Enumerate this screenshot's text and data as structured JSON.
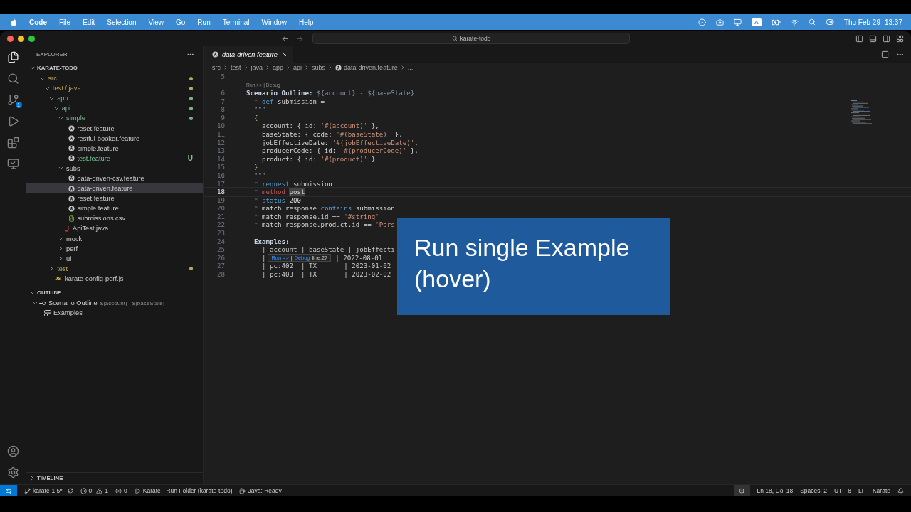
{
  "menu_bar": {
    "app": "Code",
    "items": [
      "File",
      "Edit",
      "Selection",
      "View",
      "Go",
      "Run",
      "Terminal",
      "Window",
      "Help"
    ],
    "input_source": "A",
    "date": "Thu Feb 29",
    "time": "13:37"
  },
  "title_bar": {
    "search": "karate-todo"
  },
  "activity_bar": {
    "source_control_badge": "1"
  },
  "explorer": {
    "title": "EXPLORER",
    "project": {
      "label": "KARATE-TODO",
      "expanded": true
    },
    "tree": [
      {
        "label": "src",
        "kind": "folder",
        "expanded": true,
        "selected": false,
        "color": "#b9a95a",
        "dot": true,
        "children": [
          {
            "label": "test / java",
            "kind": "folder",
            "expanded": true,
            "selected": false,
            "color": "#b9a95a",
            "dot": true,
            "children": [
              {
                "label": "app",
                "kind": "folder",
                "expanded": true,
                "selected": false,
                "color": "#79b48c",
                "dot": true,
                "children": [
                  {
                    "label": "api",
                    "kind": "folder",
                    "expanded": true,
                    "selected": false,
                    "color": "#79b48c",
                    "dot": true,
                    "children": [
                      {
                        "label": "simple",
                        "kind": "folder",
                        "expanded": true,
                        "selected": false,
                        "color": "#79b48c",
                        "dot": true,
                        "children": [
                          {
                            "label": "reset.feature",
                            "kind": "feature",
                            "selected": false
                          },
                          {
                            "label": "restful-booker.feature",
                            "kind": "feature",
                            "selected": false
                          },
                          {
                            "label": "simple.feature",
                            "kind": "feature",
                            "selected": false
                          },
                          {
                            "label": "test.feature",
                            "kind": "feature",
                            "selected": false,
                            "color": "#73c991",
                            "badge": "U"
                          }
                        ]
                      },
                      {
                        "label": "subs",
                        "kind": "folder",
                        "expanded": true,
                        "selected": false,
                        "children": [
                          {
                            "label": "data-driven-csv.feature",
                            "kind": "feature",
                            "selected": false
                          },
                          {
                            "label": "data-driven.feature",
                            "kind": "feature",
                            "selected": true
                          },
                          {
                            "label": "reset.feature",
                            "kind": "feature",
                            "selected": false
                          },
                          {
                            "label": "simple.feature",
                            "kind": "feature",
                            "selected": false
                          },
                          {
                            "label": "submissions.csv",
                            "kind": "csv",
                            "selected": false
                          }
                        ]
                      },
                      {
                        "label": "ApiTest.java",
                        "kind": "java",
                        "selected": false
                      },
                      {
                        "label": "mock",
                        "kind": "folder",
                        "expanded": false,
                        "selected": false
                      },
                      {
                        "label": "perf",
                        "kind": "folder",
                        "expanded": false,
                        "selected": false
                      },
                      {
                        "label": "ui",
                        "kind": "folder",
                        "expanded": false,
                        "selected": false
                      }
                    ]
                  }
                ]
              },
              {
                "label": "test",
                "kind": "folder",
                "expanded": false,
                "selected": false,
                "color": "#b9a95a",
                "dot": true
              },
              {
                "label": "karate-config-perf.js",
                "kind": "js",
                "type_label": "JS",
                "selected": false
              }
            ]
          }
        ]
      }
    ]
  },
  "outline": {
    "title": "OUTLINE",
    "expanded": true,
    "items": [
      {
        "label": "Scenario Outline",
        "detail": "${account} - ${baseState}",
        "expanded": true,
        "children": [
          {
            "label": "Examples"
          }
        ]
      }
    ]
  },
  "timeline": {
    "title": "TIMELINE",
    "expanded": false
  },
  "tabs": [
    {
      "label": "data-driven.feature",
      "selected": true
    }
  ],
  "breadcrumbs": [
    {
      "label": "src",
      "kind": "folder"
    },
    {
      "label": "test",
      "kind": "folder"
    },
    {
      "label": "java",
      "kind": "folder"
    },
    {
      "label": "app",
      "kind": "folder"
    },
    {
      "label": "api",
      "kind": "folder"
    },
    {
      "label": "subs",
      "kind": "folder"
    },
    {
      "label": "data-driven.feature",
      "kind": "file"
    },
    {
      "label": "...",
      "kind": "more"
    }
  ],
  "editor": {
    "lines": [
      {
        "n": "5",
        "current": false
      },
      {
        "n": "6",
        "current": false,
        "codelens": "Run >> | Debug",
        "tokens": [
          {
            "t": "Scenario Outline:",
            "kind": "keyword"
          },
          {
            "t": " ${account} - ${baseState}",
            "kind": "muted"
          }
        ]
      },
      {
        "n": "7",
        "current": false,
        "tokens": [
          {
            "t": "  *",
            "kind": "star"
          },
          {
            "t": " def",
            "kind": "blue"
          },
          {
            "t": " submission =",
            "kind": "plain"
          }
        ]
      },
      {
        "n": "8",
        "current": false,
        "tokens": [
          {
            "t": "  \"\"\"",
            "kind": "muted"
          }
        ]
      },
      {
        "n": "9",
        "current": false,
        "tokens": [
          {
            "t": "  {",
            "kind": "bracket"
          }
        ]
      },
      {
        "n": "10",
        "current": false,
        "tokens": [
          {
            "t": "    account: { id: ",
            "kind": "plain"
          },
          {
            "t": "'#(account)'",
            "kind": "string"
          },
          {
            "t": " },",
            "kind": "plain"
          }
        ]
      },
      {
        "n": "11",
        "current": false,
        "tokens": [
          {
            "t": "    baseState: { code: ",
            "kind": "plain"
          },
          {
            "t": "'#(baseState)'",
            "kind": "string"
          },
          {
            "t": " },",
            "kind": "plain"
          }
        ]
      },
      {
        "n": "12",
        "current": false,
        "tokens": [
          {
            "t": "    jobEffectiveDate: ",
            "kind": "plain"
          },
          {
            "t": "'#(jobEffectiveDate)'",
            "kind": "string"
          },
          {
            "t": ",",
            "kind": "plain"
          }
        ]
      },
      {
        "n": "13",
        "current": false,
        "tokens": [
          {
            "t": "    producerCode: { id: ",
            "kind": "plain"
          },
          {
            "t": "'#(producerCode)'",
            "kind": "string"
          },
          {
            "t": " },",
            "kind": "plain"
          }
        ]
      },
      {
        "n": "14",
        "current": false,
        "tokens": [
          {
            "t": "    product: { id: ",
            "kind": "plain"
          },
          {
            "t": "'#(product)'",
            "kind": "string"
          },
          {
            "t": " }",
            "kind": "plain"
          }
        ]
      },
      {
        "n": "15",
        "current": false,
        "tokens": [
          {
            "t": "  }",
            "kind": "bracket"
          }
        ]
      },
      {
        "n": "16",
        "current": false,
        "tokens": [
          {
            "t": "  \"\"\"",
            "kind": "muted"
          }
        ]
      },
      {
        "n": "17",
        "current": false,
        "tokens": [
          {
            "t": "  *",
            "kind": "star"
          },
          {
            "t": " request",
            "kind": "blue"
          },
          {
            "t": " submission",
            "kind": "plain"
          }
        ]
      },
      {
        "n": "18",
        "current": true,
        "tokens": [
          {
            "t": "  *",
            "kind": "star"
          },
          {
            "t": " method ",
            "kind": "red"
          },
          {
            "t": "post",
            "kind": "highlight"
          }
        ]
      },
      {
        "n": "19",
        "current": false,
        "tokens": [
          {
            "t": "  *",
            "kind": "star"
          },
          {
            "t": " status",
            "kind": "blue"
          },
          {
            "t": " 200",
            "kind": "plain"
          }
        ]
      },
      {
        "n": "20",
        "current": false,
        "tokens": [
          {
            "t": "  *",
            "kind": "star"
          },
          {
            "t": " match response",
            "kind": "plain"
          },
          {
            "t": " contains",
            "kind": "blue"
          },
          {
            "t": " submission",
            "kind": "plain"
          }
        ]
      },
      {
        "n": "21",
        "current": false,
        "tokens": [
          {
            "t": "  *",
            "kind": "star"
          },
          {
            "t": " match response.id == ",
            "kind": "plain"
          },
          {
            "t": "'#string'",
            "kind": "string"
          }
        ]
      },
      {
        "n": "22",
        "current": false,
        "tokens": [
          {
            "t": "  *",
            "kind": "star"
          },
          {
            "t": " match response.product.id == ",
            "kind": "plain"
          },
          {
            "t": "'Pers",
            "kind": "string"
          }
        ]
      },
      {
        "n": "23",
        "current": false
      },
      {
        "n": "24",
        "current": false,
        "tokens": [
          {
            "t": "  Examples:",
            "kind": "keyword"
          }
        ]
      },
      {
        "n": "25",
        "current": false,
        "tokens": [
          {
            "t": "    | account | baseState | jobEffecti",
            "kind": "table"
          }
        ]
      },
      {
        "n": "26",
        "current": false,
        "hover": true,
        "tokens": [
          {
            "t": "    |",
            "kind": "table"
          },
          {
            "t": "| 2022-08-01",
            "kind": "table"
          }
        ]
      },
      {
        "n": "27",
        "current": false,
        "tokens": [
          {
            "t": "    | pc:402  | TX       | 2023-01-02",
            "kind": "table"
          }
        ]
      },
      {
        "n": "28",
        "current": false,
        "tokens": [
          {
            "t": "    | pc:403  | TX       | 2023-02-02",
            "kind": "table"
          }
        ]
      }
    ]
  },
  "hover": {
    "run": "Run >>",
    "separator": "|",
    "debug": "Debug",
    "info": "line:27"
  },
  "caption": {
    "text": "Run single Example (hover)"
  },
  "status_bar": {
    "branch": "karate-1.5*",
    "errors": "0",
    "warnings": "1",
    "ports": "0",
    "task": "Karate - Run Folder (karate-todo)",
    "java": "Java: Ready",
    "position": "Ln 18, Col 18",
    "spaces": "Spaces: 2",
    "encoding": "UTF-8",
    "eol": "LF",
    "language": "Karate"
  }
}
